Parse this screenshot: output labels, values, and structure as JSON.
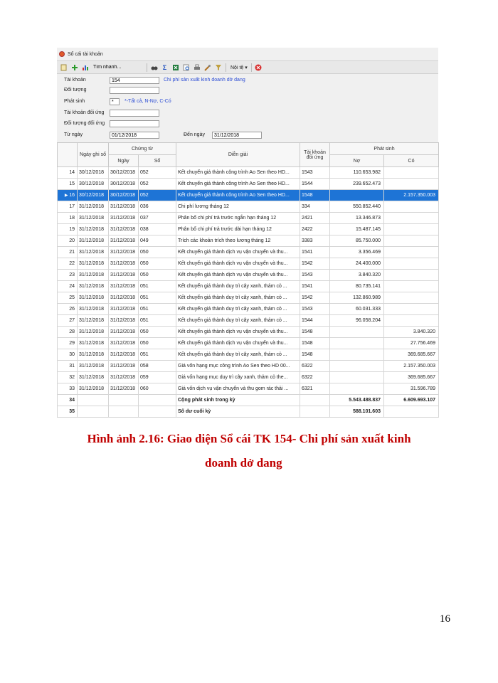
{
  "window": {
    "title": "Sổ cái tài khoản"
  },
  "toolbar": {
    "quick_search": "Tìm nhanh...",
    "currency": "Nội tệ",
    "currency_arrow": "▾"
  },
  "form": {
    "account_label": "Tài khoản",
    "account_value": "154",
    "account_name": "Chi phí sản xuất kinh doanh dở dang",
    "object_label": "Đối tượng",
    "object_value": "",
    "arise_label": "Phát sinh",
    "arise_value": "*",
    "arise_hint": "*-Tất cả, N-Nợ, C-Có",
    "counter_account_label": "Tài khoản đối ứng",
    "counter_account_value": "",
    "counter_object_label": "Đối tượng đối ứng",
    "counter_object_value": "",
    "from_date_label": "Từ ngày",
    "from_date": "01/12/2018",
    "to_date_label": "Đến ngày",
    "to_date": "31/12/2018"
  },
  "grid": {
    "headers": {
      "record_date": "Ngày ghi sổ",
      "voucher": "Chứng từ",
      "voucher_date": "Ngày",
      "voucher_no": "Số",
      "description": "Diễn giải",
      "counter_account": "Tài khoản đối ứng",
      "arise": "Phát sinh",
      "debit": "Nợ",
      "credit": "Có"
    },
    "rows": [
      {
        "stt": "14",
        "date": "30/12/2018",
        "vdate": "30/12/2018",
        "vno": "052",
        "desc": "Kết chuyển giá thành công trình Ao Sen theo HD...",
        "acc": "1543",
        "debit": "110.653.982",
        "credit": ""
      },
      {
        "stt": "15",
        "date": "30/12/2018",
        "vdate": "30/12/2018",
        "vno": "052",
        "desc": "Kết chuyển giá thành công trình Ao Sen theo HD...",
        "acc": "1544",
        "debit": "239.652.473",
        "credit": ""
      },
      {
        "stt": "16",
        "date": "30/12/2018",
        "vdate": "30/12/2018",
        "vno": "052",
        "desc": "Kết chuyển giá thành công trình Ao Sen theo HD...",
        "acc": "1548",
        "debit": "",
        "credit": "2.157.350.003",
        "selected": true
      },
      {
        "stt": "17",
        "date": "31/12/2018",
        "vdate": "31/12/2018",
        "vno": "036",
        "desc": "Chi phí lương tháng 12",
        "acc": "334",
        "debit": "550.852.440",
        "credit": ""
      },
      {
        "stt": "18",
        "date": "31/12/2018",
        "vdate": "31/12/2018",
        "vno": "037",
        "desc": "Phân bổ chi phí trả trước ngắn hạn tháng 12",
        "acc": "2421",
        "debit": "13.346.873",
        "credit": ""
      },
      {
        "stt": "19",
        "date": "31/12/2018",
        "vdate": "31/12/2018",
        "vno": "038",
        "desc": "Phân bổ chi phí trả trước dài hạn tháng 12",
        "acc": "2422",
        "debit": "15.487.145",
        "credit": ""
      },
      {
        "stt": "20",
        "date": "31/12/2018",
        "vdate": "31/12/2018",
        "vno": "049",
        "desc": "Trích các khoản trích theo lương tháng 12",
        "acc": "3383",
        "debit": "85.750.000",
        "credit": ""
      },
      {
        "stt": "21",
        "date": "31/12/2018",
        "vdate": "31/12/2018",
        "vno": "050",
        "desc": "Kết chuyển giá thành dịch vụ vận chuyển và thu...",
        "acc": "1541",
        "debit": "3.356.469",
        "credit": ""
      },
      {
        "stt": "22",
        "date": "31/12/2018",
        "vdate": "31/12/2018",
        "vno": "050",
        "desc": "Kết chuyển giá thành dịch vụ vận chuyển và thu...",
        "acc": "1542",
        "debit": "24.400.000",
        "credit": ""
      },
      {
        "stt": "23",
        "date": "31/12/2018",
        "vdate": "31/12/2018",
        "vno": "050",
        "desc": "Kết chuyển giá thành dịch vụ vận chuyển và thu...",
        "acc": "1543",
        "debit": "3.840.320",
        "credit": ""
      },
      {
        "stt": "24",
        "date": "31/12/2018",
        "vdate": "31/12/2018",
        "vno": "051",
        "desc": "Kết chuyển giá thành duy trì cây xanh, thảm cỏ ...",
        "acc": "1541",
        "debit": "80.735.141",
        "credit": ""
      },
      {
        "stt": "25",
        "date": "31/12/2018",
        "vdate": "31/12/2018",
        "vno": "051",
        "desc": "Kết chuyển giá thành duy trì cây xanh, thảm cỏ ...",
        "acc": "1542",
        "debit": "132.860.989",
        "credit": ""
      },
      {
        "stt": "26",
        "date": "31/12/2018",
        "vdate": "31/12/2018",
        "vno": "051",
        "desc": "Kết chuyển giá thành duy trì cây xanh, thảm cỏ ...",
        "acc": "1543",
        "debit": "60.031.333",
        "credit": ""
      },
      {
        "stt": "27",
        "date": "31/12/2018",
        "vdate": "31/12/2018",
        "vno": "051",
        "desc": "Kết chuyển giá thành duy trì cây xanh, thảm cỏ ...",
        "acc": "1544",
        "debit": "96.058.204",
        "credit": ""
      },
      {
        "stt": "28",
        "date": "31/12/2018",
        "vdate": "31/12/2018",
        "vno": "050",
        "desc": "Kết chuyển giá thành dịch vụ vận chuyển và thu...",
        "acc": "1548",
        "debit": "",
        "credit": "3.840.320"
      },
      {
        "stt": "29",
        "date": "31/12/2018",
        "vdate": "31/12/2018",
        "vno": "050",
        "desc": "Kết chuyển giá thành dịch vụ vận chuyển và thu...",
        "acc": "1548",
        "debit": "",
        "credit": "27.756.469"
      },
      {
        "stt": "30",
        "date": "31/12/2018",
        "vdate": "31/12/2018",
        "vno": "051",
        "desc": "Kết chuyển giá thành duy trì cây xanh, thảm cỏ ...",
        "acc": "1548",
        "debit": "",
        "credit": "369.685.667"
      },
      {
        "stt": "31",
        "date": "31/12/2018",
        "vdate": "31/12/2018",
        "vno": "058",
        "desc": "Giá vốn hạng mục công trình Ao Sen theo HD 00...",
        "acc": "6322",
        "debit": "",
        "credit": "2.157.350.003"
      },
      {
        "stt": "32",
        "date": "31/12/2018",
        "vdate": "31/12/2018",
        "vno": "059",
        "desc": "Giá vốn hạng mục duy trì cây xanh, thảm cỏ  the...",
        "acc": "6322",
        "debit": "",
        "credit": "369.685.667"
      },
      {
        "stt": "33",
        "date": "31/12/2018",
        "vdate": "31/12/2018",
        "vno": "060",
        "desc": "Giá vốn dịch vụ vận chuyển và thu gom rác thải ...",
        "acc": "6321",
        "debit": "",
        "credit": "31.596.789"
      },
      {
        "stt": "34",
        "date": "",
        "vdate": "",
        "vno": "",
        "desc": "Cộng phát sinh trong kỳ",
        "acc": "",
        "debit": "5.543.488.837",
        "credit": "6.609.693.107",
        "bold": true
      },
      {
        "stt": "35",
        "date": "",
        "vdate": "",
        "vno": "",
        "desc": "Số dư cuối kỳ",
        "acc": "",
        "debit": "588.101.603",
        "credit": "",
        "bold": true
      }
    ]
  },
  "caption": {
    "line1": "Hình ảnh 2.16: Giao diện Sổ cái TK 154- Chi phí sản xuất kinh",
    "line2": "doanh dở dang"
  },
  "page_number": "16",
  "colors": {
    "selection": "#1e74d6",
    "caption": "#c00000",
    "link_blue": "#2a4bd4"
  }
}
